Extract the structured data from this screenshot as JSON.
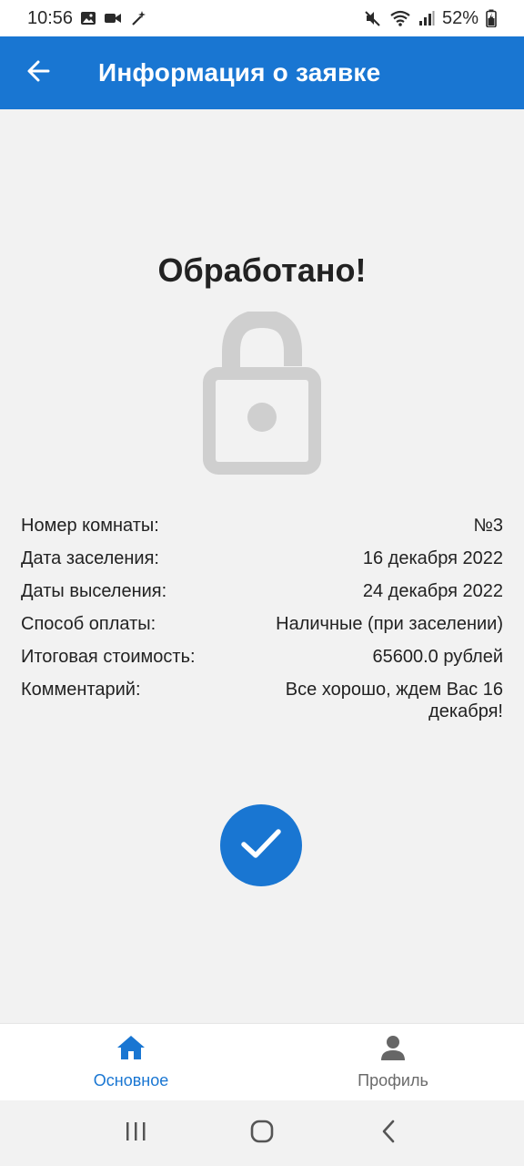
{
  "status_bar": {
    "time": "10:56",
    "battery": "52%",
    "left_icons": [
      "image-icon",
      "video-icon",
      "magic-wand-icon"
    ],
    "right_icons": [
      "mute-icon",
      "wifi-icon",
      "signal-icon",
      "battery-icon"
    ]
  },
  "app_bar": {
    "title": "Информация о заявке",
    "back_icon": "arrow-back-icon",
    "color": "#1976d2"
  },
  "status": {
    "title": "Обработано!",
    "icon": "lock-open-icon"
  },
  "details": [
    {
      "label": "Номер комнаты:",
      "value": "№3"
    },
    {
      "label": "Дата заселения:",
      "value": "16 декабря 2022"
    },
    {
      "label": "Даты выселения:",
      "value": "24 декабря 2022"
    },
    {
      "label": "Способ оплаты:",
      "value": "Наличные (при заселении)"
    },
    {
      "label": "Итоговая стоимость:",
      "value": "65600.0 рублей"
    },
    {
      "label": "Комментарий:",
      "value": "Все хорошо, ждем Вас 16 декабря!"
    }
  ],
  "fab": {
    "icon": "check-icon"
  },
  "bottom_nav": {
    "items": [
      {
        "label": "Основное",
        "icon": "home-icon",
        "active": true
      },
      {
        "label": "Профиль",
        "icon": "person-icon",
        "active": false
      }
    ]
  },
  "system_nav": {
    "buttons": [
      "recents-icon",
      "home-circle-icon",
      "back-chevron-icon"
    ]
  }
}
